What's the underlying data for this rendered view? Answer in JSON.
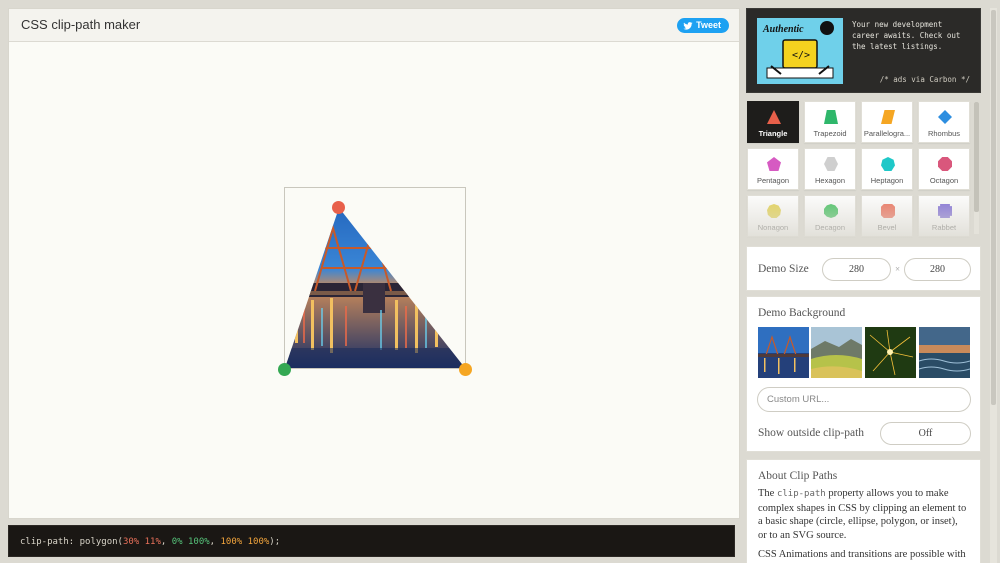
{
  "app": {
    "title": "CSS clip-path maker",
    "tweet_label": "Tweet"
  },
  "code": {
    "prefix": "clip-path: polygon(",
    "p1": "30% 11%",
    "sep1": ", ",
    "p2": "0% 100%",
    "sep2": ", ",
    "p3": "100% 100%",
    "suffix": ");"
  },
  "colors": {
    "point1": "#e8604a",
    "point2": "#34a853",
    "point3": "#f5a623",
    "active_shape": "#1e1d1b"
  },
  "ad": {
    "text": "Your new development career awaits. Check out the latest listings.",
    "note": "/* ads via Carbon */",
    "logo_text": "Authentic"
  },
  "shapes": [
    {
      "label": "Triangle",
      "icon": "triangle-icon",
      "color": "#e8604a"
    },
    {
      "label": "Trapezoid",
      "icon": "trapezoid-icon",
      "color": "#2fb76b"
    },
    {
      "label": "Parallelogra...",
      "icon": "parallelogram-icon",
      "color": "#f5a623"
    },
    {
      "label": "Rhombus",
      "icon": "rhombus-icon",
      "color": "#2d8ee0"
    },
    {
      "label": "Pentagon",
      "icon": "pentagon-icon",
      "color": "#d65ac2"
    },
    {
      "label": "Hexagon",
      "icon": "hexagon-icon",
      "color": "#cfcfcf"
    },
    {
      "label": "Heptagon",
      "icon": "heptagon-icon",
      "color": "#1fc8c8"
    },
    {
      "label": "Octagon",
      "icon": "octagon-icon",
      "color": "#d9577c"
    },
    {
      "label": "Nonagon",
      "icon": "nonagon-icon",
      "color": "#e4d24c"
    },
    {
      "label": "Decagon",
      "icon": "decagon-icon",
      "color": "#3cc05a"
    },
    {
      "label": "Bevel",
      "icon": "bevel-icon",
      "color": "#ee6b55"
    },
    {
      "label": "Rabbet",
      "icon": "rabbet-icon",
      "color": "#7b68d8"
    }
  ],
  "demo_size": {
    "label": "Demo Size",
    "width": "280",
    "height": "280",
    "times": "×"
  },
  "demo_background": {
    "label": "Demo Background",
    "url_placeholder": "Custom URL...",
    "outside_label": "Show outside clip-path",
    "outside_value": "Off"
  },
  "about": {
    "title": "About Clip Paths",
    "p1_before": "The ",
    "p1_code": "clip-path",
    "p1_after": " property allows you to make complex shapes in CSS by clipping an element to a basic shape (circle, ellipse, polygon, or inset), or to an SVG source.",
    "p2": "CSS Animations and transitions are possible with two or more clip-path shapes with the"
  }
}
